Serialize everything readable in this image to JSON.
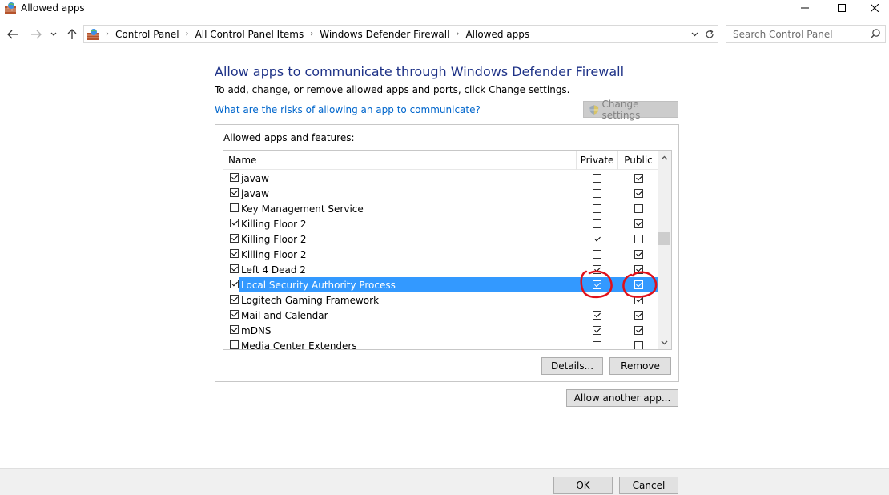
{
  "window": {
    "title": "Allowed apps"
  },
  "navigation": {
    "breadcrumbs": [
      "Control Panel",
      "All Control Panel Items",
      "Windows Defender Firewall",
      "Allowed apps"
    ],
    "search_placeholder": "Search Control Panel"
  },
  "main": {
    "heading": "Allow apps to communicate through Windows Defender Firewall",
    "subtext": "To add, change, or remove allowed apps and ports, click Change settings.",
    "risk_link": "What are the risks of allowing an app to communicate?",
    "change_settings_label": "Change settings",
    "group_label": "Allowed apps and features:",
    "columns": {
      "name": "Name",
      "private": "Private",
      "public": "Public"
    },
    "apps": [
      {
        "name": "javaw",
        "enabled": true,
        "private": false,
        "public": true
      },
      {
        "name": "javaw",
        "enabled": true,
        "private": false,
        "public": true
      },
      {
        "name": "Key Management Service",
        "enabled": false,
        "private": false,
        "public": false
      },
      {
        "name": "Killing Floor 2",
        "enabled": true,
        "private": false,
        "public": true
      },
      {
        "name": "Killing Floor 2",
        "enabled": true,
        "private": true,
        "public": false
      },
      {
        "name": "Killing Floor 2",
        "enabled": true,
        "private": false,
        "public": true
      },
      {
        "name": "Left 4 Dead 2",
        "enabled": true,
        "private": true,
        "public": true
      },
      {
        "name": "Local Security Authority Process",
        "enabled": true,
        "private": true,
        "public": true,
        "selected": true
      },
      {
        "name": "Logitech Gaming Framework",
        "enabled": true,
        "private": false,
        "public": true
      },
      {
        "name": "Mail and Calendar",
        "enabled": true,
        "private": true,
        "public": true
      },
      {
        "name": "mDNS",
        "enabled": true,
        "private": true,
        "public": true
      },
      {
        "name": "Media Center Extenders",
        "enabled": false,
        "private": false,
        "public": false
      }
    ],
    "details_label": "Details...",
    "remove_label": "Remove",
    "allow_another_label": "Allow another app..."
  },
  "footer": {
    "ok_label": "OK",
    "cancel_label": "Cancel"
  },
  "colors": {
    "heading": "#1e3287",
    "link": "#0066cc",
    "selection": "#3399ff",
    "annotation": "#e0101a"
  }
}
